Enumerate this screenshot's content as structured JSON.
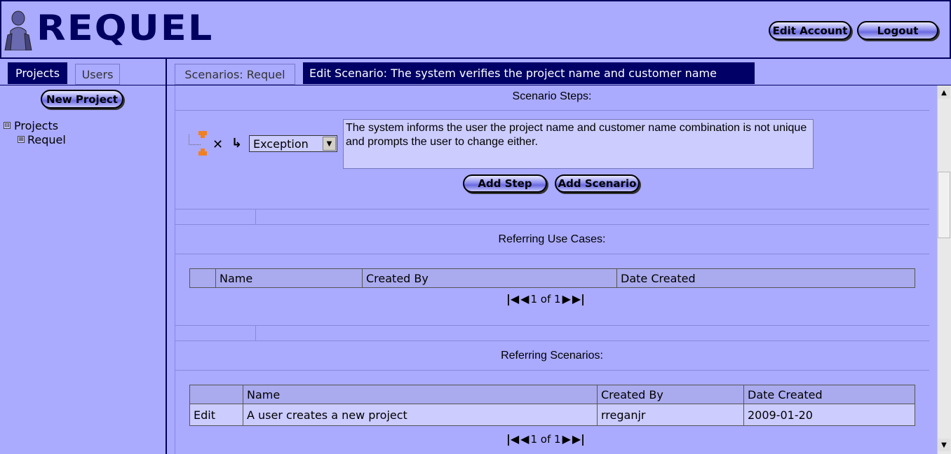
{
  "app": {
    "logo_text": "REQUEL"
  },
  "header": {
    "edit_account_label": "Edit Account",
    "logout_label": "Logout"
  },
  "left_panel": {
    "tabs": [
      {
        "label": "Projects",
        "active": true
      },
      {
        "label": "Users",
        "active": false
      }
    ],
    "new_project_label": "New Project",
    "tree": {
      "root_toggle": "⊟",
      "root_label": "Projects",
      "child_toggle": "⊞",
      "child_label": "Requel"
    }
  },
  "main": {
    "tabs": [
      {
        "label": "Scenarios: Requel",
        "active": false
      },
      {
        "label": "Edit Scenario: The system verifies the project name and customer name",
        "active": true
      }
    ],
    "scenario_steps": {
      "title": "Scenario Steps:",
      "step": {
        "type": "Exception",
        "text": "The system informs the user the project name and customer name combination is not unique and prompts the user to change either."
      },
      "add_step_label": "Add Step",
      "add_scenario_label": "Add Scenario"
    },
    "referring_use_cases": {
      "title": "Referring Use Cases:",
      "columns": [
        "",
        "Name",
        "Created By",
        "Date Created"
      ],
      "rows": [],
      "pager": "1 of 1"
    },
    "referring_scenarios": {
      "title": "Referring Scenarios:",
      "columns": [
        "",
        "Name",
        "Created By",
        "Date Created"
      ],
      "rows": [
        {
          "action": "Edit",
          "name": "A user creates a new project",
          "created_by": "rreganjr",
          "date_created": "2009-01-20"
        }
      ],
      "pager": "1 of 1"
    }
  },
  "colors": {
    "background": "#aaaaff",
    "accent_dark": "#000066",
    "field_bg": "#ccccff"
  }
}
